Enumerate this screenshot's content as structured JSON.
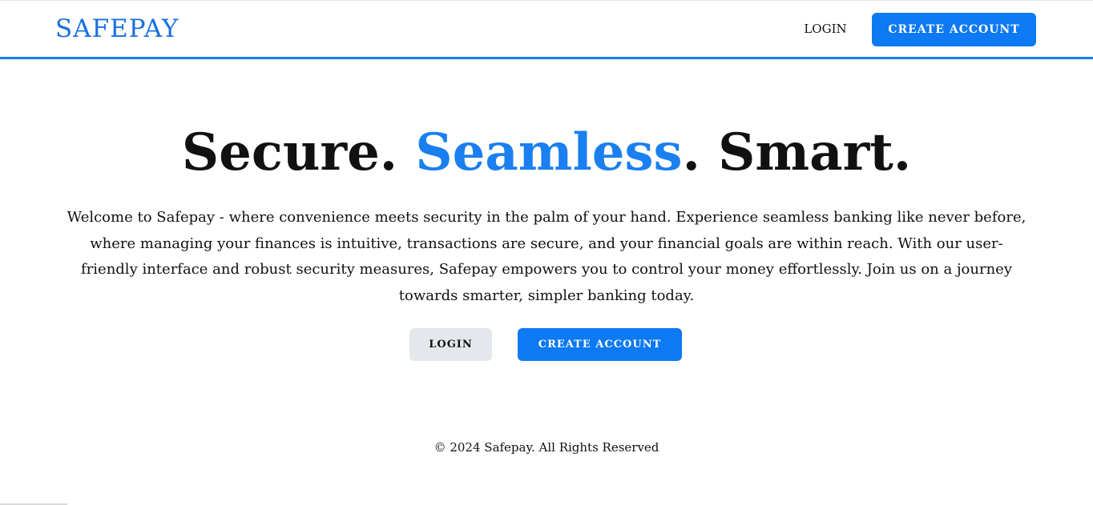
{
  "navbar": {
    "brand": "SAFEPAY",
    "login_label": "LOGIN",
    "create_account_label": "CREATE ACCOUNT"
  },
  "hero": {
    "title_part1": "Secure. ",
    "title_accent": "Seamless",
    "title_part2": ". Smart.",
    "description": "Welcome to Safepay - where convenience meets security in the palm of your hand. Experience seamless banking like never before, where managing your finances is intuitive, transactions are secure, and your financial goals are within reach. With our user-friendly interface and robust security measures, Safepay empowers you to control your money effortlessly. Join us on a journey towards smarter, simpler banking today.",
    "login_label": "LOGIN",
    "create_account_label": "CREATE ACCOUNT"
  },
  "footer": {
    "copyright": "© 2024 Safepay. All Rights Reserved"
  },
  "colors": {
    "accent": "#1a7ff0",
    "button_primary": "#0d79f2",
    "button_secondary": "#e4e7eb"
  }
}
